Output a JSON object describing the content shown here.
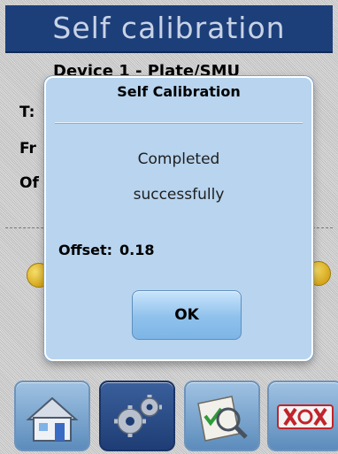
{
  "header": {
    "title": "Self calibration"
  },
  "background": {
    "device_header": "Device 1 - Plate/SMU",
    "row_labels": [
      "T:",
      "Fr",
      "Of"
    ]
  },
  "dialog": {
    "title": "Self Calibration",
    "message_line1": "Completed",
    "message_line2": "successfully",
    "offset_label": "Offset:",
    "offset_value": "0.18",
    "ok_label": "OK"
  },
  "toolbar": {
    "buttons": [
      {
        "icon": "home-icon"
      },
      {
        "icon": "gears-icon",
        "active": true
      },
      {
        "icon": "inspect-icon"
      },
      {
        "icon": "exit-icon"
      }
    ]
  },
  "colors": {
    "title_bar": "#1c3f7a",
    "dialog_bg": "#b8d4ee",
    "ok_button": "#8fc1ec",
    "accent_dot": "#e8c23a"
  }
}
